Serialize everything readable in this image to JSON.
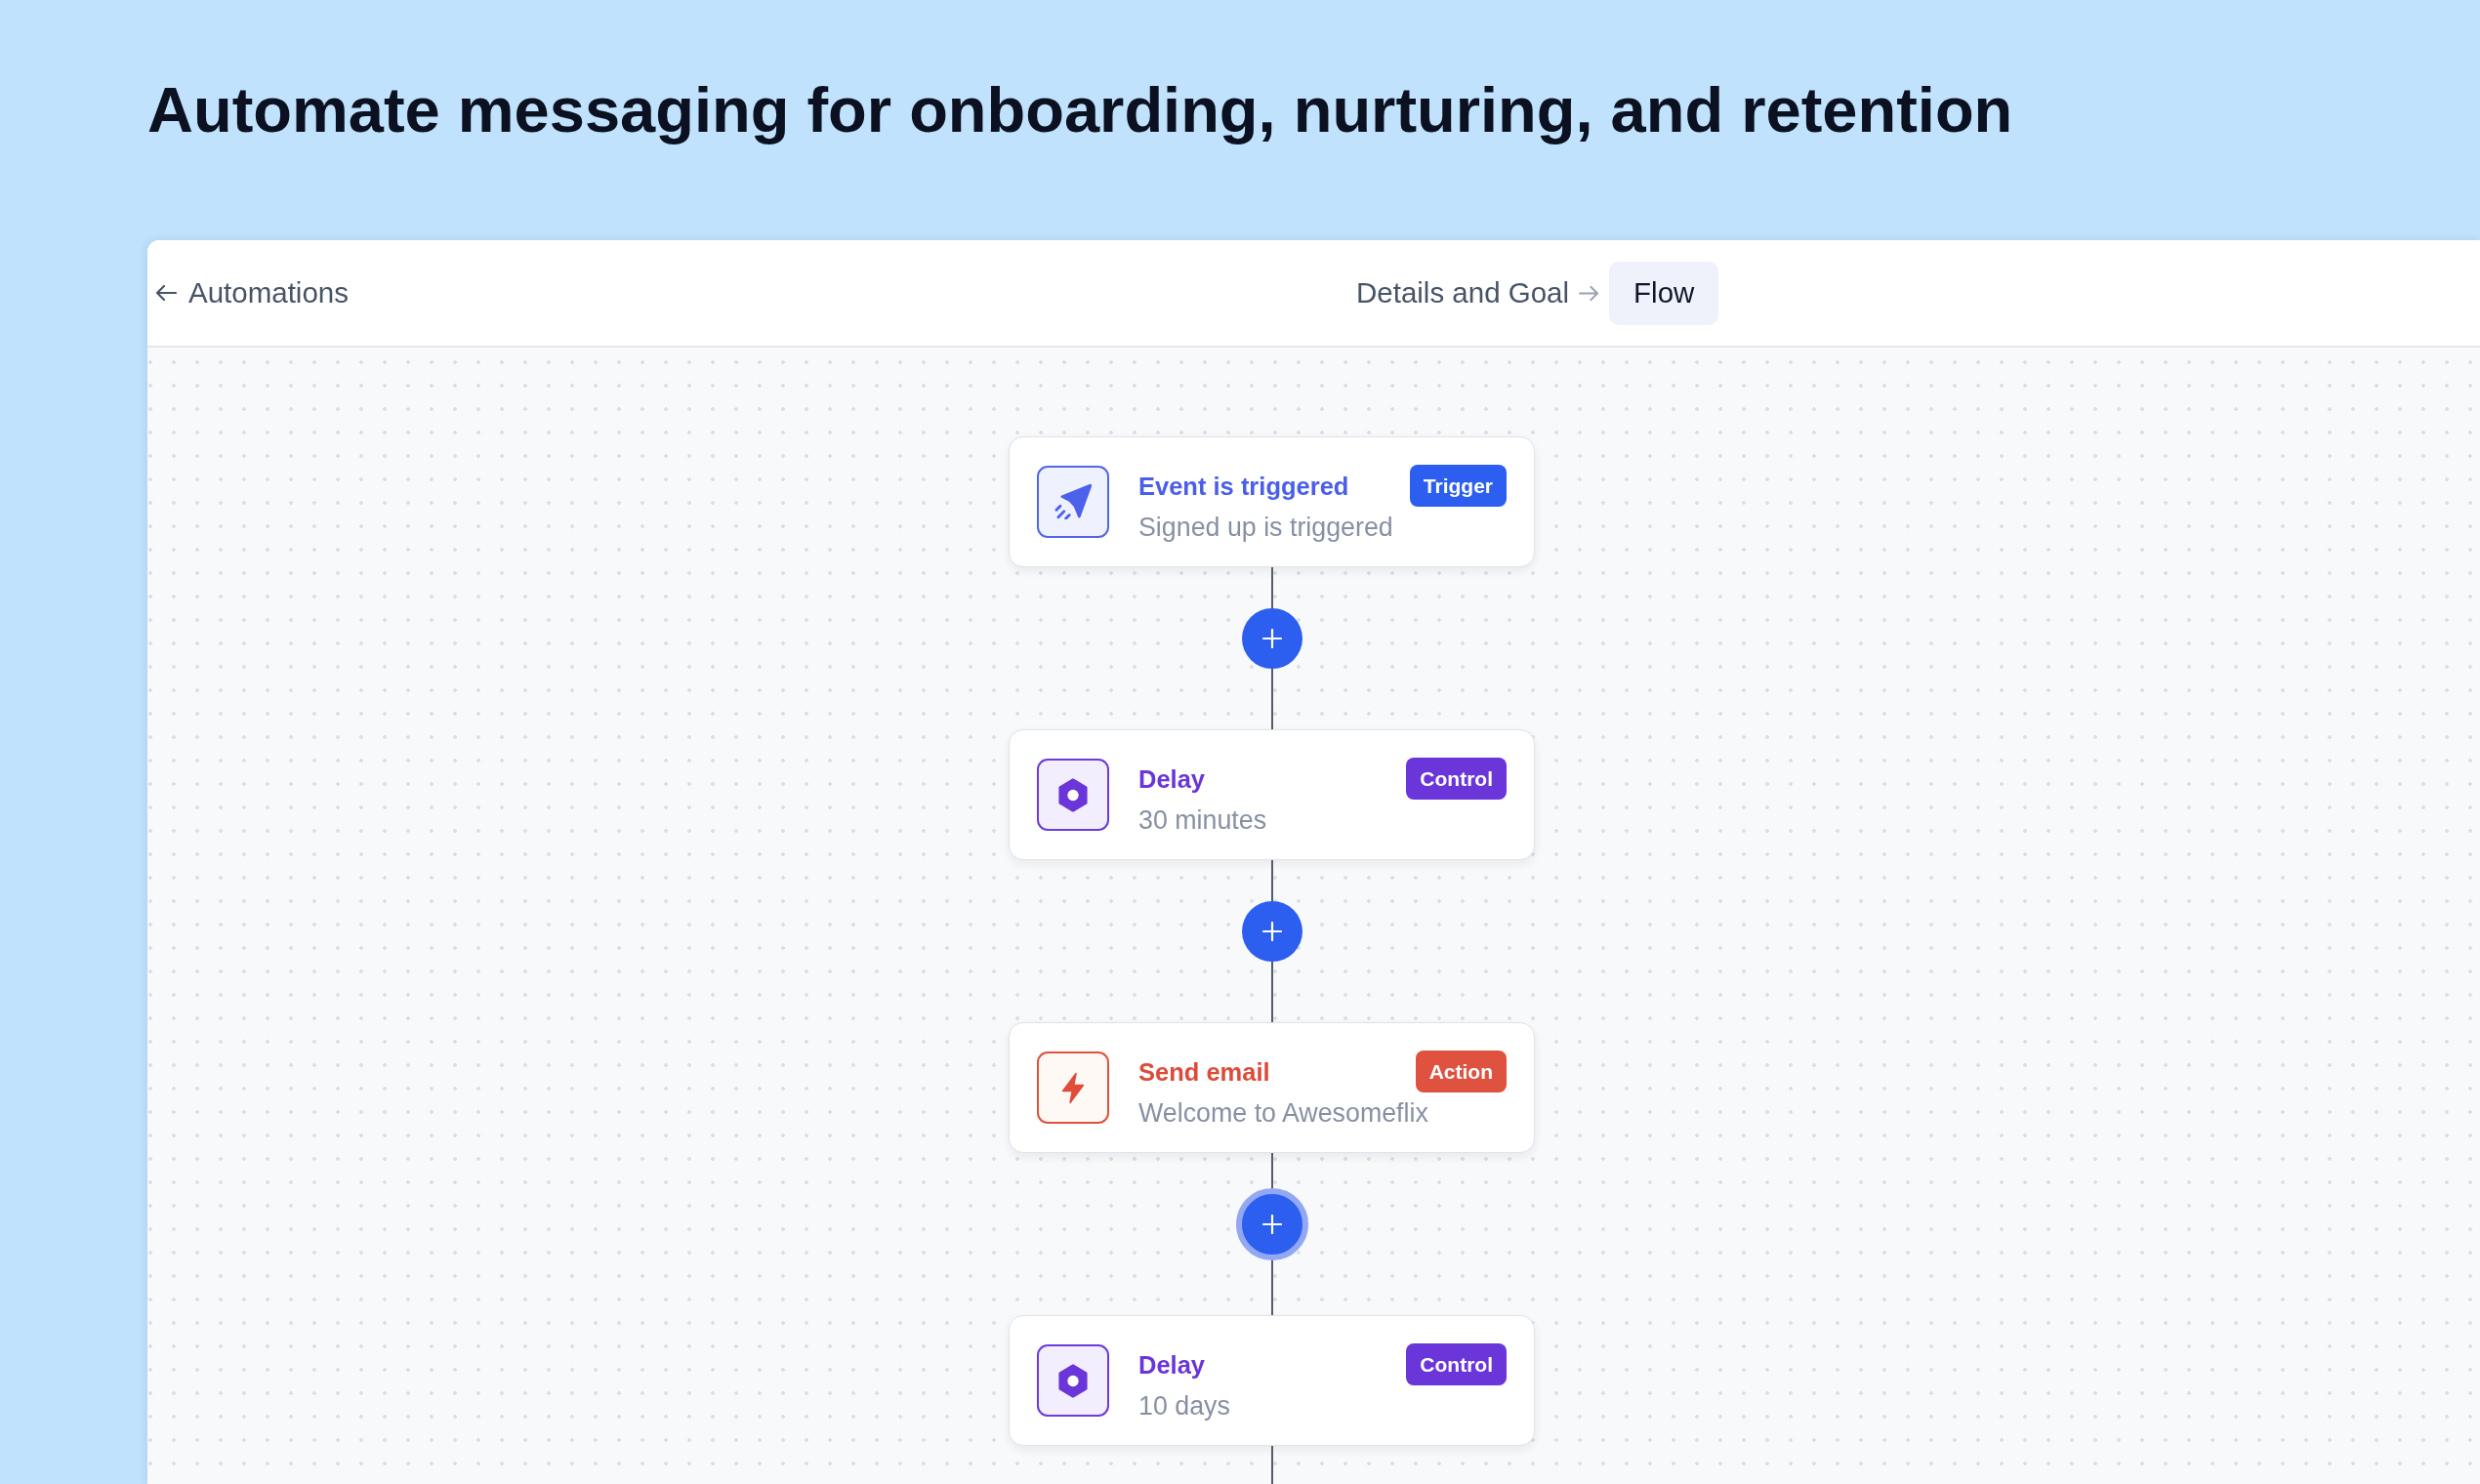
{
  "headline": "Automate messaging for onboarding, nurturing, and retention",
  "header": {
    "back_link": "Automations",
    "steps": [
      {
        "label": "Details and Goal",
        "selected": false
      },
      {
        "label": "Flow",
        "selected": true
      }
    ]
  },
  "flow": [
    {
      "kind": "trigger",
      "title": "Event is triggered",
      "subtitle": "Signed up is triggered",
      "badge": "Trigger",
      "add_after": {
        "focused": false
      }
    },
    {
      "kind": "control",
      "title": "Delay",
      "subtitle": "30 minutes",
      "badge": "Control",
      "add_after": {
        "focused": false
      }
    },
    {
      "kind": "action",
      "title": "Send email",
      "subtitle": "Welcome to Awesomeflix",
      "badge": "Action",
      "add_after": {
        "focused": true
      }
    },
    {
      "kind": "control",
      "title": "Delay",
      "subtitle": "10 days",
      "badge": "Control"
    }
  ]
}
